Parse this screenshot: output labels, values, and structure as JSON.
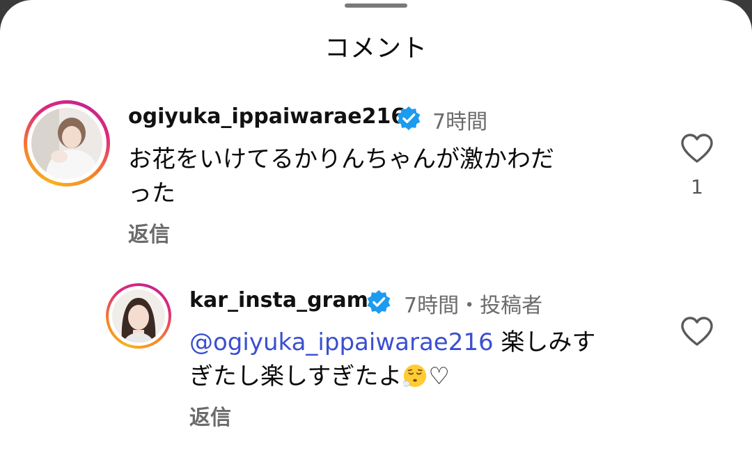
{
  "header": {
    "title": "コメント"
  },
  "comments": [
    {
      "username": "ogiyuka_ippaiwarae216",
      "time": "7時間",
      "text_line1": "お花をいけてるかりんちゃんが激かわだ",
      "text_line2": "った",
      "reply_label": "返信",
      "like_count": "1"
    },
    {
      "username": "kar_insta_gram",
      "time": "7時間・投稿者",
      "mention": "@ogiyuka_ippaiwarae216",
      "text_line1_rest": "楽しみす",
      "text_line2": "ぎたし楽しすぎたよ",
      "text_suffix": "♡",
      "emoji": "face-exhaling-icon",
      "reply_label": "返信"
    }
  ],
  "colors": {
    "verified": "#1d9bf0",
    "mention": "#3a4fd0",
    "secondary_text": "#6b6b6b"
  }
}
